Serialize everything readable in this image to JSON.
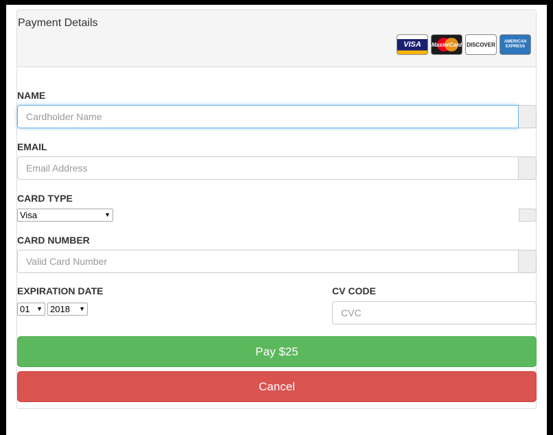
{
  "header": {
    "title": "Payment Details",
    "card_logos": [
      {
        "name": "visa-card-logo",
        "text": "VISA"
      },
      {
        "name": "mastercard-logo",
        "text": "MasterCard"
      },
      {
        "name": "discover-card-logo",
        "text": "DISCOVER"
      },
      {
        "name": "amex-card-logo",
        "text": "AMERICAN EXPRESS"
      }
    ]
  },
  "form": {
    "name": {
      "label": "NAME",
      "placeholder": "Cardholder Name"
    },
    "email": {
      "label": "EMAIL",
      "placeholder": "Email Address"
    },
    "card_type": {
      "label": "CARD TYPE",
      "selected": "Visa"
    },
    "card_number": {
      "label": "CARD NUMBER",
      "placeholder": "Valid Card Number"
    },
    "expiration": {
      "label": "EXPIRATION DATE",
      "month": "01",
      "year": "2018"
    },
    "cvc": {
      "label": "CV CODE",
      "placeholder": "CVC"
    }
  },
  "actions": {
    "pay_label": "Pay $25",
    "cancel_label": "Cancel"
  },
  "colors": {
    "pay": "#5cb85c",
    "cancel": "#d9534f",
    "focus": "#66afe9"
  }
}
